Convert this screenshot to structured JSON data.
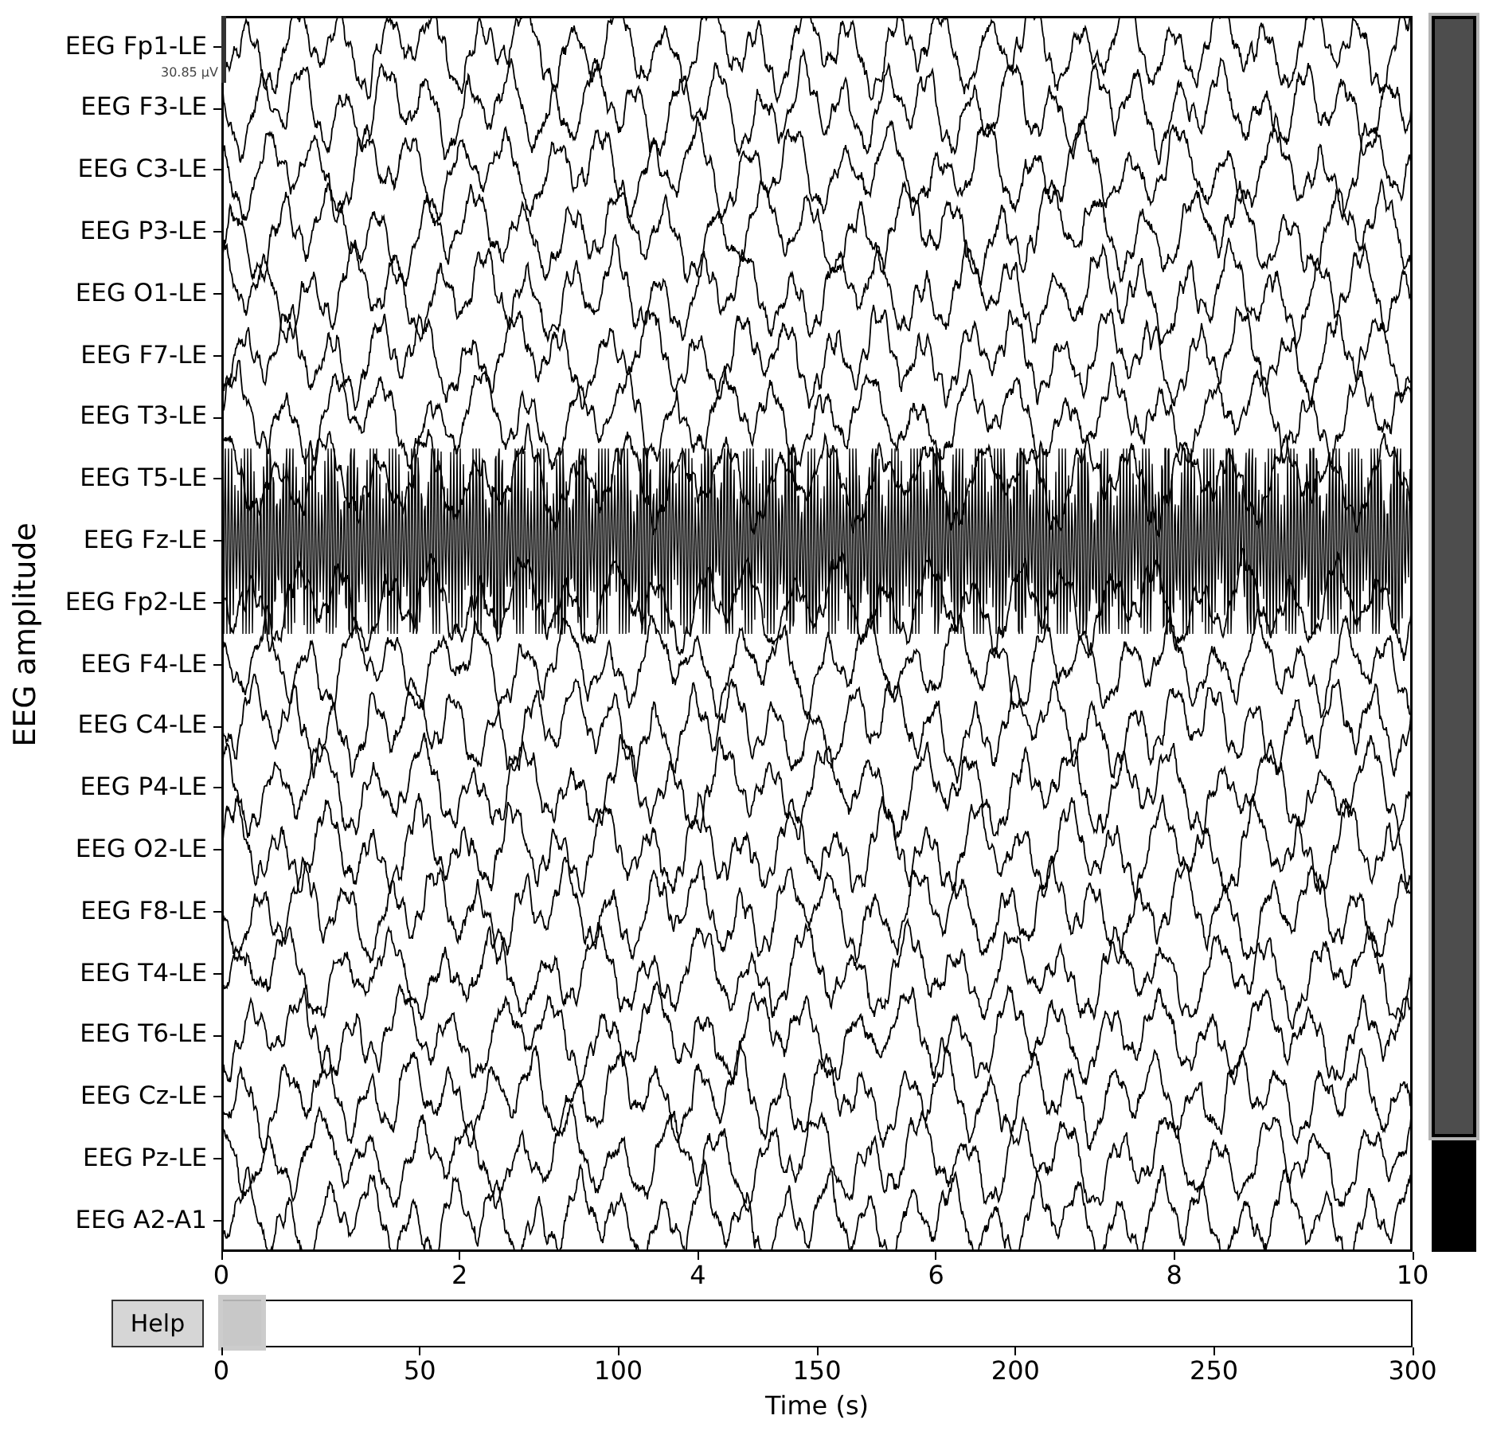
{
  "eeg_plot": {
    "ylabel": "EEG amplitude",
    "channels": [
      "EEG Fp1-LE",
      "EEG F3-LE",
      "EEG C3-LE",
      "EEG P3-LE",
      "EEG O1-LE",
      "EEG F7-LE",
      "EEG T3-LE",
      "EEG T5-LE",
      "EEG Fz-LE",
      "EEG Fp2-LE",
      "EEG F4-LE",
      "EEG C4-LE",
      "EEG P4-LE",
      "EEG O2-LE",
      "EEG F8-LE",
      "EEG T4-LE",
      "EEG T6-LE",
      "EEG Cz-LE",
      "EEG Pz-LE",
      "EEG A2-A1"
    ],
    "scale_label": "30.85 µV",
    "xticks": [
      "0",
      "2",
      "4",
      "6",
      "8",
      "10"
    ]
  },
  "help_button": {
    "label": "Help"
  },
  "time_overview": {
    "xticks": [
      "0",
      "50",
      "100",
      "150",
      "200",
      "250",
      "300"
    ],
    "xlabel": "Time (s)"
  }
}
